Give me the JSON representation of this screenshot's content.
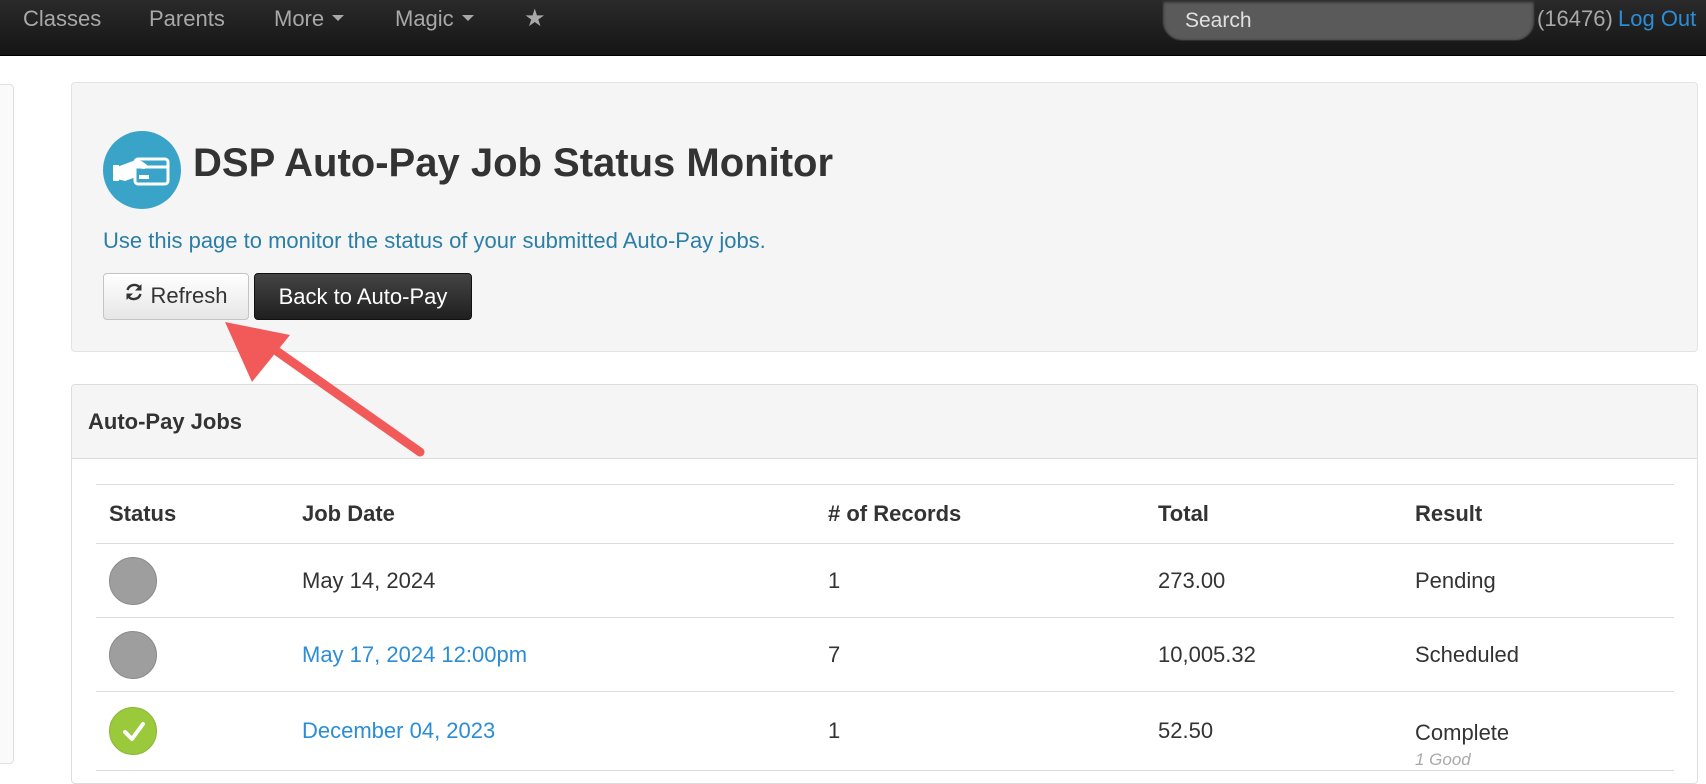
{
  "navbar": {
    "items": [
      {
        "label": "Classes",
        "has_caret": false
      },
      {
        "label": "Parents",
        "has_caret": false
      },
      {
        "label": "More",
        "has_caret": true
      },
      {
        "label": "Magic",
        "has_caret": true
      }
    ],
    "star_icon": "star-icon",
    "search": {
      "placeholder": "Search",
      "value": ""
    },
    "user_id": "(16476)",
    "logout_label": "Log Out"
  },
  "header": {
    "icon": "payment-card-hand-icon",
    "icon_color": "#3aa3c8",
    "title": "DSP Auto-Pay Job Status Monitor",
    "subtitle": "Use this page to monitor the status of your submitted Auto-Pay jobs.",
    "refresh_label": "Refresh",
    "back_label": "Back to Auto-Pay"
  },
  "annotation": {
    "arrow_color": "#f25a5a",
    "points_to": "refresh-button"
  },
  "jobs_panel": {
    "title": "Auto-Pay Jobs",
    "columns": [
      "Status",
      "Job Date",
      "# of Records",
      "Total",
      "Result"
    ],
    "rows": [
      {
        "status": "pending",
        "status_color": "#9e9e9e",
        "job_date": "May 14, 2024",
        "date_is_link": false,
        "records": "1",
        "total": "273.00",
        "result": "Pending",
        "sub_result": ""
      },
      {
        "status": "scheduled",
        "status_color": "#9e9e9e",
        "job_date": "May 17, 2024 12:00pm",
        "date_is_link": true,
        "records": "7",
        "total": "10,005.32",
        "result": "Scheduled",
        "sub_result": ""
      },
      {
        "status": "complete",
        "status_color": "#9bc93c",
        "job_date": "December 04, 2023",
        "date_is_link": true,
        "records": "1",
        "total": "52.50",
        "result": "Complete",
        "sub_result": "1 Good"
      }
    ]
  }
}
